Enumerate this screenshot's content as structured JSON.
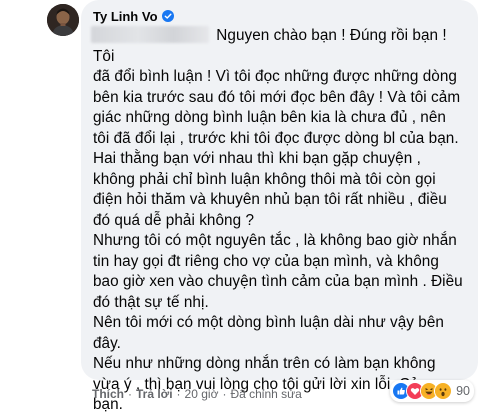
{
  "comment": {
    "author": "Ty Linh Vo",
    "verified": true,
    "first_line_rest": " Nguyen chào bạn ! Đúng rồi bạn ! Tôi",
    "paragraphs": [
      "đã đổi bình luận ! Vì tôi đọc những được những dòng bên kia trước sau đó tôi mới đọc bên đây ! Và tôi cảm giác những dòng bình luận bên kia là chưa đủ , nên tôi đã đổi lại , trước khi tôi đọc được dòng bl của bạn.",
      "Hai thằng bạn với nhau thì khi bạn gặp chuyện , không phải chỉ bình luận không thôi mà tôi còn gọi điện hỏi thăm và khuyên nhủ bạn tôi rất nhiều , điều đó quá dễ phải không ?",
      "Nhưng tôi có một nguyên tắc , là không bao giờ nhắn tin hay gọi đt riêng cho vợ của bạn mình, và không bao giờ xen vào chuyện tình cảm của bạn mình . Điều đó thật sự tế nhị.",
      "Nên tôi mới có một dòng bình luận dài như vậy bên đây.",
      "Nếu như những dòng nhắn trên có làm bạn không vừa ý , thì bạn vui lòng cho tôi gửi lời xin lỗi. Cảm ơn bạn."
    ]
  },
  "actions": {
    "like": "Thích",
    "reply": "Trả lời",
    "time": "20 giờ",
    "edited": "Đã chỉnh sửa",
    "separator": "·"
  },
  "reactions": {
    "icons": [
      "like-icon",
      "love-icon",
      "haha-icon",
      "wow-icon"
    ],
    "count": "90",
    "colors": {
      "like": "#1877f2",
      "love": "#f33e58",
      "haha": "#f7b125",
      "wow": "#f7b125"
    }
  },
  "colors": {
    "bubble": "#f0f2f5",
    "text": "#050505",
    "secondary": "#65676b",
    "verified": "#1877f2"
  }
}
